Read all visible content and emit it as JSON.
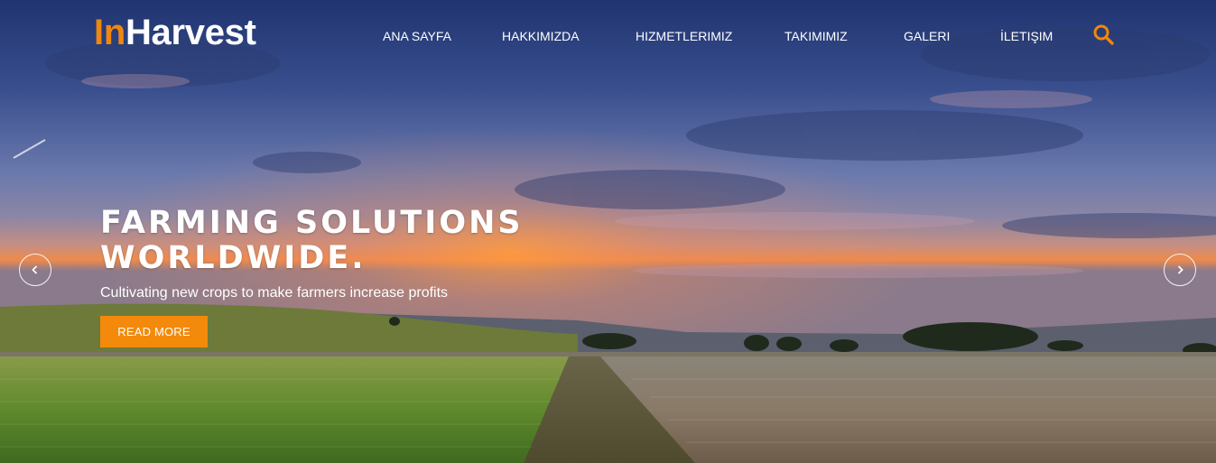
{
  "brand": {
    "logo_prefix": "In",
    "logo_suffix": "Harvest",
    "accent_color": "#f0870f"
  },
  "nav": {
    "items": [
      {
        "label": "ANA SAYFA"
      },
      {
        "label": "HAKKIMIZDA"
      },
      {
        "label": "HIZMETLERIMIZ"
      },
      {
        "label": "TAKIMIMIZ"
      },
      {
        "label": "GALERI"
      },
      {
        "label": "İLETIŞIM"
      }
    ],
    "search_icon": "search-icon"
  },
  "hero": {
    "title_line1": "FARMING SOLUTIONS",
    "title_line2": "WORLDWIDE.",
    "subtitle": "Cultivating new crops to make farmers increase profits",
    "cta_label": "READ MORE",
    "cta_color": "#f48a0b",
    "prev_icon": "chevron-left-icon",
    "next_icon": "chevron-right-icon"
  }
}
